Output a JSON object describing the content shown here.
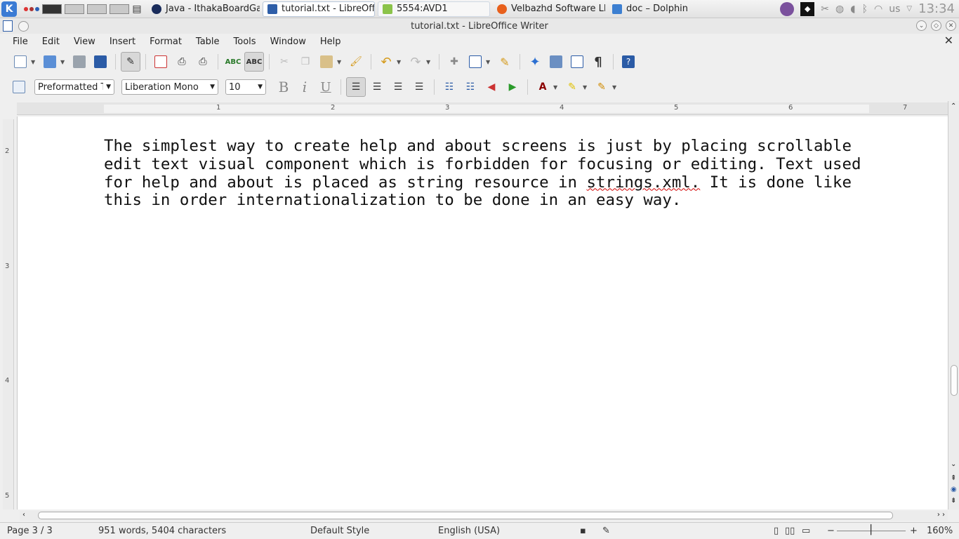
{
  "taskbar": {
    "tasks": [
      {
        "label": "Java - IthakaBoardGam",
        "icon_color": "#1a2c5b"
      },
      {
        "label": "tutorial.txt - LibreOffic",
        "icon_color": "#2e5ea8"
      },
      {
        "label": "5554:AVD1",
        "icon_color": "#8bc34a"
      },
      {
        "label": "Velbazhd Software LLC",
        "icon_color": "#e8601c"
      },
      {
        "label": "doc – Dolphin",
        "icon_color": "#3c7fd1"
      }
    ],
    "keyboard": "us",
    "clock": "13:34"
  },
  "window": {
    "title": "tutorial.txt - LibreOffice Writer"
  },
  "menu": [
    "File",
    "Edit",
    "View",
    "Insert",
    "Format",
    "Table",
    "Tools",
    "Window",
    "Help"
  ],
  "format": {
    "paragraph_style": "Preformatted Te",
    "font_name": "Liberation Mono",
    "font_size": "10",
    "bold": "B",
    "italic": "i",
    "underline": "U"
  },
  "ruler": {
    "h_ticks": [
      "1",
      "2",
      "3",
      "4",
      "5",
      "6",
      "7"
    ],
    "v_ticks": [
      "2",
      "3",
      "4",
      "5"
    ]
  },
  "document": {
    "lines": [
      "The simplest way to create help and about screens is just by placing scrollable",
      "edit text visual component which is forbidden for focusing or editing. Text used",
      "for help and about is placed as string resource in ",
      "strings.xml.",
      " It is done like",
      "this in order internationalization to be done in an easy way."
    ]
  },
  "status": {
    "page": "Page 3 / 3",
    "words": "951 words, 5404 characters",
    "style": "Default Style",
    "language": "English (USA)",
    "zoom": "160%"
  },
  "colors": {
    "accent": "#3b7bd4",
    "spell_error": "#d00000"
  }
}
